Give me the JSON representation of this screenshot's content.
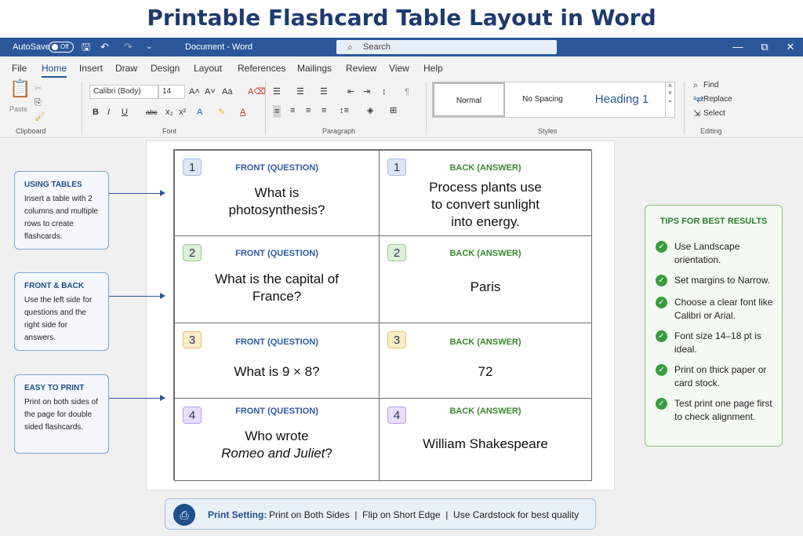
{
  "page_title": "Printable Flashcard Table Layout in Word",
  "titlebar": {
    "autosave_label": "AutoSave",
    "autosave_state": "Off",
    "doc_name": "Document - Word",
    "search_placeholder": "Search"
  },
  "tabs": [
    "File",
    "Home",
    "Insert",
    "Draw",
    "Design",
    "Layout",
    "References",
    "Mailings",
    "Review",
    "View",
    "Help"
  ],
  "active_tab": "Home",
  "ribbon": {
    "clipboard": {
      "label": "Clipboard",
      "paste": "Paste"
    },
    "font": {
      "label": "Font",
      "font_name": "Calibri (Body)",
      "font_size": "14"
    },
    "paragraph": {
      "label": "Paragraph"
    },
    "styles": {
      "label": "Styles",
      "normal": "Normal",
      "no_spacing": "No Spacing",
      "heading1": "Heading 1"
    },
    "editing": {
      "label": "Editing",
      "find": "Find",
      "replace": "Replace",
      "select": "Select"
    }
  },
  "cards": [
    {
      "num": "1",
      "badge_color": "#dde6f5",
      "front_label": "FRONT (QUESTION)",
      "back_label": "BACK (ANSWER)",
      "question": "What is photosynthesis?",
      "answer": "Process plants use to convert sunlight into energy."
    },
    {
      "num": "2",
      "badge_color": "#dcefd8",
      "front_label": "FRONT (QUESTION)",
      "back_label": "BACK (ANSWER)",
      "question": "What is the capital of France?",
      "answer": "Paris"
    },
    {
      "num": "3",
      "badge_color": "#fbecc8",
      "front_label": "FRONT (QUESTION)",
      "back_label": "BACK (ANSWER)",
      "question": "What is 9 × 8?",
      "answer": "72"
    },
    {
      "num": "4",
      "badge_color": "#e7defa",
      "front_label": "FRONT (QUESTION)",
      "back_label": "BACK (ANSWER)",
      "question_line1": "Who wrote",
      "question_line2": "Romeo and Juliet",
      "question_suffix": "?",
      "answer": "William Shakespeare"
    }
  ],
  "info_boxes": [
    {
      "title": "USING TABLES",
      "text": "Insert a table with 2 columns and multiple rows to create flashcards."
    },
    {
      "title": "FRONT & BACK",
      "text": "Use the left side for questions and the right side for answers."
    },
    {
      "title": "EASY TO PRINT",
      "text": "Print on both sides of the page for double sided flashcards."
    }
  ],
  "tips": {
    "title": "TIPS FOR BEST RESULTS",
    "items": [
      "Use Landscape orientation.",
      "Set margins to Narrow.",
      "Choose a clear font like Calibri or Arial.",
      "Font size 14–18 pt is ideal.",
      "Print on thick paper or card stock.",
      "Test print one page first to check alignment."
    ]
  },
  "print_bar": {
    "label": "Print Setting:",
    "value": "Print on Both Sides  |  Flip on Short Edge  |  Use Cardstock for best quality"
  },
  "colors": {
    "word_blue": "#2b579a",
    "front_blue": "#2e5aa6",
    "back_green": "#3a8a2f"
  }
}
